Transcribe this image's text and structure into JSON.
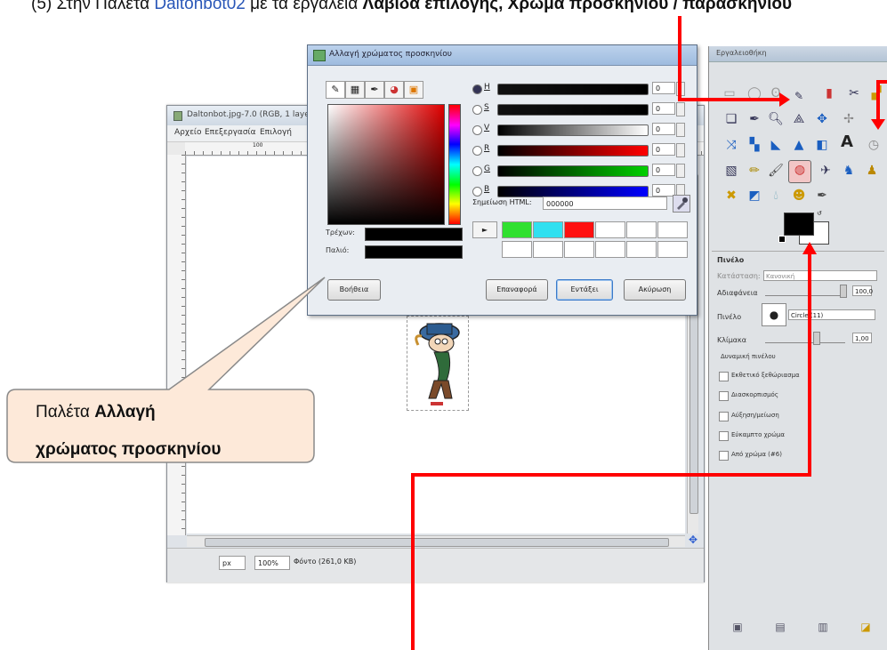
{
  "figure": {
    "caption_prefix": "(5) Στην Παλέτα ",
    "caption_blue": "Daltonbot02",
    "caption_mid": " με τα εργαλεία ",
    "caption_bold": "Λαβίδα επιλογής, Χρώμα προσκηνίου / παρασκηνίου",
    "callout_line1_normal": "Παλέτα ",
    "callout_line1_bold": "Αλλαγή",
    "callout_line2_bold": "χρώματος προσκηνίου",
    "colors": {
      "accent_red": "#ff0000",
      "callout_fill": "#fde9d9",
      "callout_border": "#8a8a8a"
    }
  },
  "image_window": {
    "title": "Daltonbot.jpg-7.0 (RGB, 1 layer) 600x600 - GIMP",
    "menu": [
      "Αρχείο",
      "Επεξεργασία",
      "Επιλογή"
    ],
    "ruler_mark": "100",
    "status_unit": "px",
    "status_zoom": "100%",
    "status_text": "Φόντο (261,0 KB)"
  },
  "color_dialog": {
    "title": "Αλλαγή χρώματος προσκηνίου",
    "tabs": [
      "brush-tab-icon",
      "scales-tab-icon",
      "pen-tab-icon",
      "wheel-tab-icon",
      "palette-tab-icon"
    ],
    "current_label": "Τρέχων:",
    "old_label": "Παλιό:",
    "sliders": [
      {
        "label": "H",
        "value": "0",
        "colors": [
          "#111111",
          "#000000"
        ]
      },
      {
        "label": "S",
        "value": "0",
        "colors": [
          "#111111",
          "#000000"
        ]
      },
      {
        "label": "V",
        "value": "0",
        "colors": [
          "#000000",
          "#ffffff"
        ]
      },
      {
        "label": "R",
        "value": "0",
        "colors": [
          "#000000",
          "#ff0000"
        ]
      },
      {
        "label": "G",
        "value": "0",
        "colors": [
          "#000000",
          "#00d000"
        ]
      },
      {
        "label": "B",
        "value": "0",
        "colors": [
          "#000000",
          "#0000ff"
        ]
      }
    ],
    "html_label": "Σημείωση HTML:",
    "html_value": "000000",
    "history_colors": [
      "#30e030",
      "#30e0f0",
      "#ff1010",
      "#ffffff",
      "#ffffff",
      "#ffffff",
      "#ffffff",
      "#ffffff",
      "#ffffff",
      "#ffffff",
      "#ffffff",
      "#ffffff"
    ],
    "buttons": {
      "help": "Βοήθεια",
      "reset": "Επαναφορά",
      "ok": "Εντάξει",
      "cancel": "Ακύρωση"
    }
  },
  "toolbox": {
    "title": "Εργαλειοθήκη",
    "options_title": "Πινέλο",
    "mode_label": "Κατάσταση:",
    "mode_value": "Κανονική",
    "opacity_label": "Αδιαφάνεια",
    "opacity_value": "100,0",
    "brush_label": "Πινέλο",
    "brush_value": "Circle (11)",
    "scale_label": "Κλίμακα",
    "scale_value": "1,00",
    "dynamics_label": "Δυναμική πινέλου",
    "options": [
      "Εκθετικό ξεθώριασμα",
      "Διασκορπισμός",
      "Αύξηση/μείωση",
      "Εύκαμπτο χρώμα",
      "Από χρώμα (#6)"
    ]
  }
}
